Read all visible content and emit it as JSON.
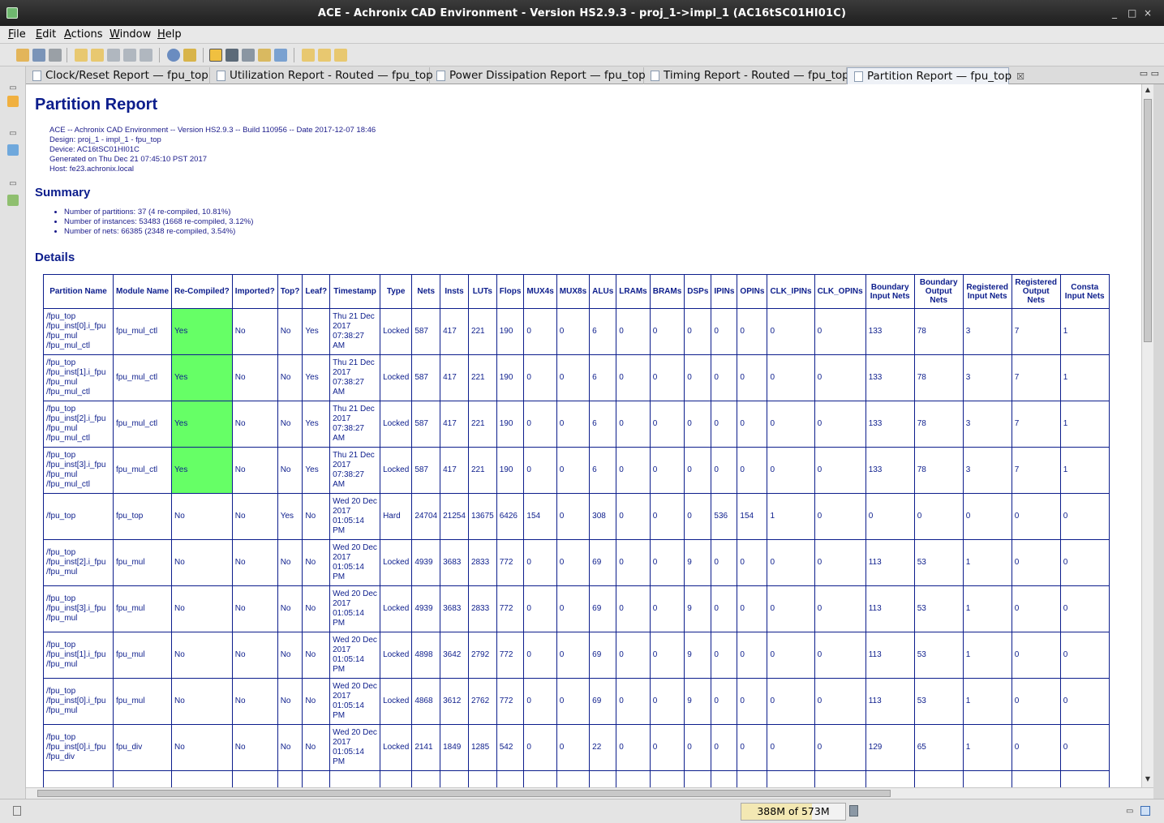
{
  "window": {
    "title": "ACE - Achronix CAD Environment - Version HS2.9.3 - proj_1->impl_1 (AC16tSC01HI01C)",
    "controls": [
      "_",
      "□",
      "×"
    ]
  },
  "menu": [
    "File",
    "Edit",
    "Actions",
    "Window",
    "Help"
  ],
  "tabs": [
    {
      "label": "Clock/Reset Report — fpu_top"
    },
    {
      "label": "Utilization Report - Routed — fpu_top"
    },
    {
      "label": "Power Dissipation Report — fpu_top"
    },
    {
      "label": "Timing Report - Routed — fpu_top"
    },
    {
      "label": "Partition Report — fpu_top",
      "active": true
    }
  ],
  "report": {
    "title": "Partition Report",
    "meta": [
      "ACE -- Achronix CAD Environment -- Version HS2.9.3 -- Build 110956 -- Date 2017-12-07 18:46",
      "Design: proj_1 - impl_1 - fpu_top",
      "Device: AC16tSC01HI01C",
      "Generated on Thu Dec 21 07:45:10 PST 2017",
      "Host: fe23.achronix.local"
    ],
    "summary_title": "Summary",
    "summary": [
      "Number of partitions: 37 (4 re-compiled, 10.81%)",
      "Number of instances: 53483 (1668 re-compiled, 3.12%)",
      "Number of nets: 66385 (2348 re-compiled, 3.54%)"
    ],
    "details_title": "Details",
    "columns": [
      "Partition Name",
      "Module Name",
      "Re-Compiled?",
      "Imported?",
      "Top?",
      "Leaf?",
      "Timestamp",
      "Type",
      "Nets",
      "Insts",
      "LUTs",
      "Flops",
      "MUX4s",
      "MUX8s",
      "ALUs",
      "LRAMs",
      "BRAMs",
      "DSPs",
      "IPINs",
      "OPINs",
      "CLK_IPINs",
      "CLK_OPINs",
      "Boundary Input Nets",
      "Boundary Output Nets",
      "Registered Input Nets",
      "Registered Output Nets",
      "Consta Input Nets"
    ],
    "rows": [
      {
        "name": "/fpu_top /fpu_inst[0].i_fpu /fpu_mul /fpu_mul_ctl",
        "cells": [
          "fpu_mul_ctl",
          "Yes",
          "No",
          "No",
          "Yes",
          "Thu 21 Dec 2017 07:38:27 AM",
          "Locked",
          "587",
          "417",
          "221",
          "190",
          "0",
          "0",
          "6",
          "0",
          "0",
          "0",
          "0",
          "0",
          "0",
          "0",
          "133",
          "78",
          "3",
          "7",
          "1"
        ]
      },
      {
        "name": "/fpu_top /fpu_inst[1].i_fpu /fpu_mul /fpu_mul_ctl",
        "cells": [
          "fpu_mul_ctl",
          "Yes",
          "No",
          "No",
          "Yes",
          "Thu 21 Dec 2017 07:38:27 AM",
          "Locked",
          "587",
          "417",
          "221",
          "190",
          "0",
          "0",
          "6",
          "0",
          "0",
          "0",
          "0",
          "0",
          "0",
          "0",
          "133",
          "78",
          "3",
          "7",
          "1"
        ]
      },
      {
        "name": "/fpu_top /fpu_inst[2].i_fpu /fpu_mul /fpu_mul_ctl",
        "cells": [
          "fpu_mul_ctl",
          "Yes",
          "No",
          "No",
          "Yes",
          "Thu 21 Dec 2017 07:38:27 AM",
          "Locked",
          "587",
          "417",
          "221",
          "190",
          "0",
          "0",
          "6",
          "0",
          "0",
          "0",
          "0",
          "0",
          "0",
          "0",
          "133",
          "78",
          "3",
          "7",
          "1"
        ]
      },
      {
        "name": "/fpu_top /fpu_inst[3].i_fpu /fpu_mul /fpu_mul_ctl",
        "cells": [
          "fpu_mul_ctl",
          "Yes",
          "No",
          "No",
          "Yes",
          "Thu 21 Dec 2017 07:38:27 AM",
          "Locked",
          "587",
          "417",
          "221",
          "190",
          "0",
          "0",
          "6",
          "0",
          "0",
          "0",
          "0",
          "0",
          "0",
          "0",
          "133",
          "78",
          "3",
          "7",
          "1"
        ]
      },
      {
        "name": "/fpu_top",
        "cells": [
          "fpu_top",
          "No",
          "No",
          "Yes",
          "No",
          "Wed 20 Dec 2017 01:05:14 PM",
          "Hard",
          "24704",
          "21254",
          "13675",
          "6426",
          "154",
          "0",
          "308",
          "0",
          "0",
          "0",
          "536",
          "154",
          "1",
          "0",
          "0",
          "0",
          "0",
          "0",
          "0"
        ]
      },
      {
        "name": "/fpu_top /fpu_inst[2].i_fpu /fpu_mul",
        "cells": [
          "fpu_mul",
          "No",
          "No",
          "No",
          "No",
          "Wed 20 Dec 2017 01:05:14 PM",
          "Locked",
          "4939",
          "3683",
          "2833",
          "772",
          "0",
          "0",
          "69",
          "0",
          "0",
          "9",
          "0",
          "0",
          "0",
          "0",
          "113",
          "53",
          "1",
          "0",
          "0"
        ]
      },
      {
        "name": "/fpu_top /fpu_inst[3].i_fpu /fpu_mul",
        "cells": [
          "fpu_mul",
          "No",
          "No",
          "No",
          "No",
          "Wed 20 Dec 2017 01:05:14 PM",
          "Locked",
          "4939",
          "3683",
          "2833",
          "772",
          "0",
          "0",
          "69",
          "0",
          "0",
          "9",
          "0",
          "0",
          "0",
          "0",
          "113",
          "53",
          "1",
          "0",
          "0"
        ]
      },
      {
        "name": "/fpu_top /fpu_inst[1].i_fpu /fpu_mul",
        "cells": [
          "fpu_mul",
          "No",
          "No",
          "No",
          "No",
          "Wed 20 Dec 2017 01:05:14 PM",
          "Locked",
          "4898",
          "3642",
          "2792",
          "772",
          "0",
          "0",
          "69",
          "0",
          "0",
          "9",
          "0",
          "0",
          "0",
          "0",
          "113",
          "53",
          "1",
          "0",
          "0"
        ]
      },
      {
        "name": "/fpu_top /fpu_inst[0].i_fpu /fpu_mul",
        "cells": [
          "fpu_mul",
          "No",
          "No",
          "No",
          "No",
          "Wed 20 Dec 2017 01:05:14 PM",
          "Locked",
          "4868",
          "3612",
          "2762",
          "772",
          "0",
          "0",
          "69",
          "0",
          "0",
          "9",
          "0",
          "0",
          "0",
          "0",
          "113",
          "53",
          "1",
          "0",
          "0"
        ]
      },
      {
        "name": "/fpu_top /fpu_inst[0].i_fpu /fpu_div",
        "cells": [
          "fpu_div",
          "No",
          "No",
          "No",
          "No",
          "Wed 20 Dec 2017 01:05:14 PM",
          "Locked",
          "2141",
          "1849",
          "1285",
          "542",
          "0",
          "0",
          "22",
          "0",
          "0",
          "0",
          "0",
          "0",
          "0",
          "0",
          "129",
          "65",
          "1",
          "0",
          "0"
        ]
      },
      {
        "name": "/fpu_top",
        "cells": [
          "",
          "",
          "",
          "",
          "",
          "Wed 20",
          "",
          "",
          "",
          "",
          "",
          "",
          "",
          "",
          "",
          "",
          "",
          "",
          "",
          "",
          "",
          "",
          "",
          "",
          "",
          ""
        ]
      }
    ]
  },
  "status": {
    "heap": "388M of 573M",
    "heap_used_fraction": 0.677
  },
  "colors": {
    "recompiled_yes": "#66ff66",
    "report_text": "#0c1d8c"
  }
}
